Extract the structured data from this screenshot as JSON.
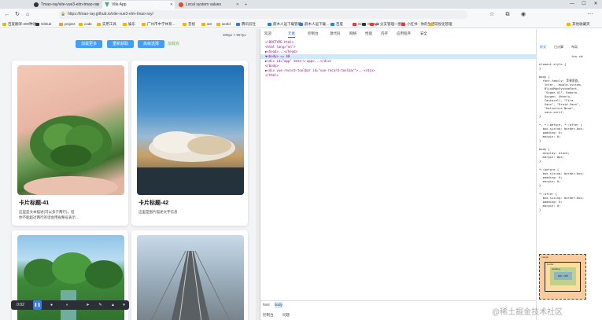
{
  "browser": {
    "tabs": [
      {
        "label": "Tmao-ray/vite-vue3-elm-tmao-ray",
        "active": false
      },
      {
        "label": "Vite App",
        "active": true
      },
      {
        "label": "Local system values",
        "active": false
      }
    ],
    "new_tab": "+",
    "address": "https://tmao-ray.github.io/vite-vue3-elm-tmao-ray/",
    "bookmarks": [
      "百度翻译-200种语...",
      "Github",
      "project",
      "code",
      "实用工具",
      "娱乐",
      "广州市中学体育...",
      "音视",
      "w3",
      "world",
      "腾讯云社",
      "蔚木人运下载管理...",
      "蔚木人运下载...",
      "百度",
      "Gi",
      "GitHub",
      "git 分支管理一图解",
      "小红书 - 你的生活...",
      "可视化管理",
      "其他收藏夹"
    ]
  },
  "page": {
    "dimensions": "309px × 957px",
    "buttons": [
      "加载更多",
      "重新获取",
      "高级选择"
    ],
    "count_text": "加载完",
    "cards": [
      {
        "title": "卡片标题-41",
        "desc": "这里是文本描述(可以多于两行)，但\n你不能超过两行的话会用省略号表示…"
      },
      {
        "title": "卡片标题-42",
        "desc": "这里是图片描述文字信息"
      },
      {
        "title": "",
        "desc": ""
      },
      {
        "title": "",
        "desc": ""
      }
    ]
  },
  "recorder": {
    "time": "0:02",
    "items": [
      "pause-icon",
      "mic-icon",
      "camera-icon",
      "pointer-icon",
      "pen-icon",
      "highlighter-icon",
      "trash-icon"
    ]
  },
  "devtools": {
    "tabs": [
      "欢迎",
      "元素",
      "控制台",
      "源代码",
      "网络",
      "性能",
      "内存",
      "应用程序",
      "安全"
    ],
    "dom_lines": [
      "<!DOCTYPE html>",
      "<html lang=\"en\">",
      "▶<head>...</head>",
      "▼<body> == $0",
      "  ▶<div id=\"app\" data-v-app>...</div>",
      "  </body>",
      "▶<div vue-record-toolbar id=\"vue-record-toolbar\">...</div>",
      "</html>"
    ],
    "bottom_tabs": [
      "html",
      "body"
    ],
    "bottom_tools": [
      "控制台",
      "问题"
    ],
    "style_tabs": [
      "样式",
      "已计算",
      "布局"
    ],
    "filter_placeholder": ":hov .cls",
    "rules": [
      "element.style {\n}",
      "body {\n  font-family: 苹果家族,\n   Inter, -apple-system,\n   BlinkMacSystemFont,\n   \"Segoe UI\", Roboto,\n   Oxygen, Ubuntu,\n   Cantarell, \"Fira\n   Sans\", \"Droid Sans\",\n   \"Helvetica Neue\",\n   sans-serif;\n}",
      "*, *::before, *::after {\n  box-sizing: border-box;\n  padding: 0;\n  margin: 0;\n}",
      "body {\n  display: block;\n  margin: 8px;\n}",
      "*::before {\n  box-sizing: border-box;\n  padding: 0;\n  margin: 0;\n}",
      "*::after {\n  box-sizing: border-box;\n  padding: 0;\n  margin: 0;\n}"
    ],
    "box_model": {
      "margin": "margin",
      "border": "border",
      "padding": "padding",
      "content": "309 × 957"
    }
  },
  "watermark": "@稀土掘金技术社区",
  "colors": {
    "primary": "#409eff",
    "success": "#67c23a"
  }
}
